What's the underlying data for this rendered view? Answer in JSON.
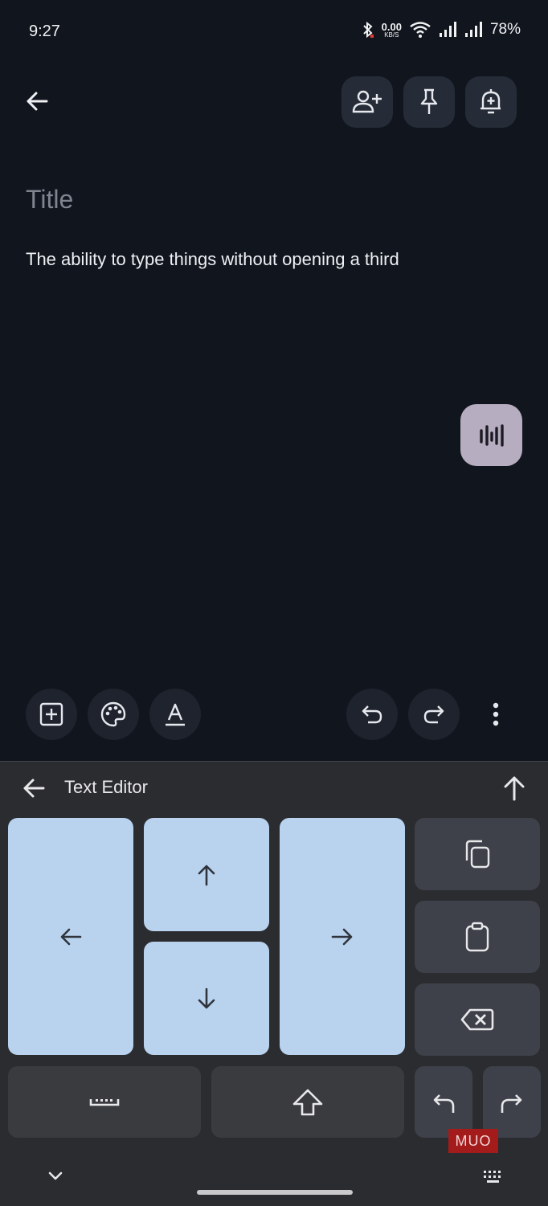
{
  "status_bar": {
    "time": "9:27",
    "net_speed_value": "0.00",
    "net_speed_unit": "KB/S",
    "battery": "78%"
  },
  "note": {
    "title_placeholder": "Title",
    "body_text": "The ability to type things without opening a third"
  },
  "keyboard": {
    "title": "Text Editor"
  },
  "watermark": "MUO",
  "colors": {
    "background": "#11151d",
    "keyboard_bg": "#2b2c30",
    "arrow_key": "#b9d3ef",
    "mic_fab": "#b6adc0"
  }
}
